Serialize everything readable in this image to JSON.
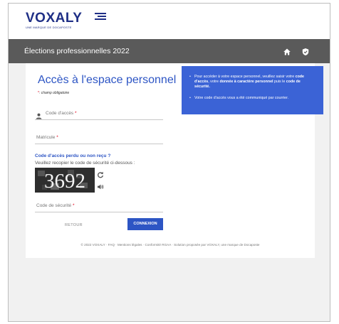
{
  "brand": {
    "logo_word": "VOXALY",
    "logo_tagline": "UNE MARQUE DE DOCAPOSTE",
    "brand_color": "#1f2f86"
  },
  "header": {
    "title": "Élections professionnelles 2022",
    "bg_color": "#5a5a5a",
    "icons": [
      "home-icon",
      "shield-icon"
    ]
  },
  "login": {
    "title": "Accès à l'espace personnel",
    "required_star": "*",
    "required_note": ": champ obligatoire",
    "access_code_label": "Code d'accès",
    "registration_label": "Matricule",
    "lost_code_link": "Code d'accès perdu ou non reçu ?",
    "copy_hint": "Veuillez recopier le code de sécurité ci-dessous :",
    "captcha_text": "3692",
    "security_code_label": "Code de sécurité",
    "back_button": "RETOUR",
    "connect_button": "CONNEXION",
    "accent_color": "#2d55c4"
  },
  "info": {
    "bullet1_a": "Pour accéder à votre espace personnel, veuillez saisir votre ",
    "bullet1_b": "code d'accès",
    "bullet1_c": ", votre ",
    "bullet1_d": "donnée à caractère personnel",
    "bullet1_e": " puis le ",
    "bullet1_f": "code de sécurité.",
    "bullet2": "Votre code d'accès vous a été communiqué par courrier.",
    "bg_color": "#3b63d6"
  },
  "footer": {
    "text": "© 2022 VOXALY · FAQ · Mentions légales · Conformité RGAA · Solution proposée par VOXALY, une marque de Docaposte"
  }
}
